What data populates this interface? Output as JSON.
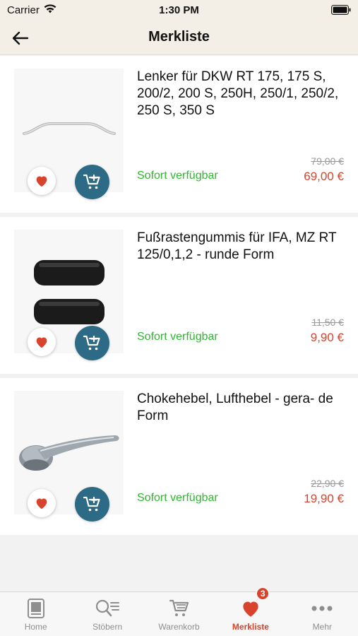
{
  "status_bar": {
    "carrier": "Carrier",
    "time": "1:30 PM"
  },
  "nav": {
    "title": "Merkliste",
    "back_icon": "arrow-left-icon"
  },
  "items": [
    {
      "name": "Lenker für DKW RT 175, 175 S, 200/2, 200 S, 250H, 250/1, 250/2, 250 S, 350 S",
      "availability": "Sofort verfügbar",
      "old_price": "79,00 €",
      "price": "69,00 €",
      "image": "handlebar"
    },
    {
      "name": "Fußrastengummis für IFA, MZ RT 125/0,1,2 - runde Form",
      "availability": "Sofort verfügbar",
      "old_price": "11,50 €",
      "price": "9,90 €",
      "image": "footrest-rubbers"
    },
    {
      "name": "Chokehebel, Lufthebel - gera- de Form",
      "availability": "Sofort verfügbar",
      "old_price": "22,90 €",
      "price": "19,90 €",
      "image": "choke-lever"
    }
  ],
  "tabs": [
    {
      "label": "Home",
      "icon": "home-icon",
      "active": false
    },
    {
      "label": "Stöbern",
      "icon": "search-list-icon",
      "active": false
    },
    {
      "label": "Warenkorb",
      "icon": "cart-icon",
      "active": false
    },
    {
      "label": "Merkliste",
      "icon": "heart-icon",
      "active": true,
      "badge": "3"
    },
    {
      "label": "Mehr",
      "icon": "more-icon",
      "active": false
    }
  ],
  "colors": {
    "accent": "#d8432c",
    "available": "#2fb52f",
    "cart_button": "#2c6a86",
    "header_bg": "#f4efe6"
  }
}
